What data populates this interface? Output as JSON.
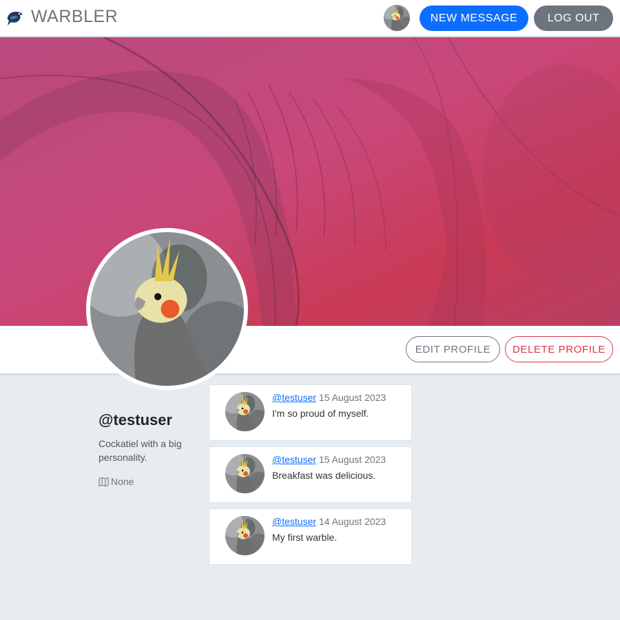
{
  "navbar": {
    "brand": "WARBLER",
    "new_message": "NEW MESSAGE",
    "logout": "LOG OUT"
  },
  "profile": {
    "edit": "EDIT PROFILE",
    "delete": "DELETE PROFILE",
    "username": "@testuser",
    "bio": "Cockatiel with a big personality.",
    "location": "None"
  },
  "messages": [
    {
      "user": "@testuser",
      "date": "15 August 2023",
      "text": "I'm so proud of myself."
    },
    {
      "user": "@testuser",
      "date": "15 August 2023",
      "text": "Breakfast was delicious."
    },
    {
      "user": "@testuser",
      "date": "14 August 2023",
      "text": "My first warble."
    }
  ],
  "colors": {
    "primary": "#0d6efd",
    "secondary": "#6c757d",
    "danger": "#dc3545",
    "background": "#e6ecf0"
  }
}
